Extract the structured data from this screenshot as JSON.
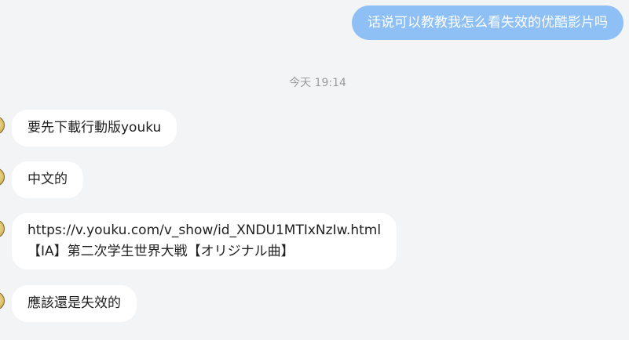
{
  "messages": {
    "outgoing": {
      "text": "话说可以教教我怎么看失效的优酷影片吗"
    },
    "timestamp": "今天 19:14",
    "incoming": [
      {
        "text": "要先下載行動版youku"
      },
      {
        "text": "中文的"
      },
      {
        "line1": "https://v.youku.com/v_show/id_XNDU1MTIxNzIw.html",
        "line2": "【IA】第二次学生世界大戦【オリジナル曲】"
      },
      {
        "text": "應該還是失效的"
      }
    ]
  },
  "colors": {
    "background": "#f3f4f6",
    "outgoing_bubble": "#8ec0f5",
    "incoming_bubble": "#ffffff",
    "timestamp_text": "#9a9a9a"
  },
  "icons": {
    "avatar": "avatar-icon"
  }
}
